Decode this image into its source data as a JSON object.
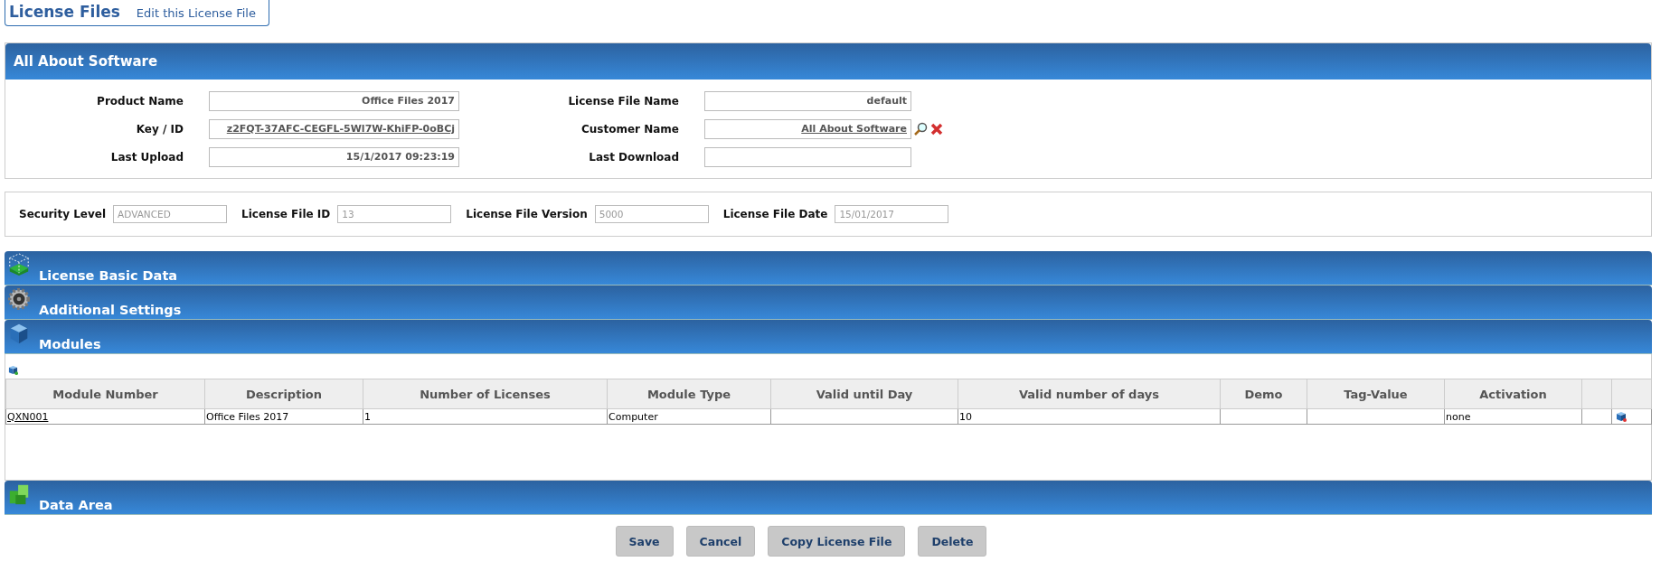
{
  "header_tab": {
    "title": "License Files",
    "link": "Edit this License File"
  },
  "software_panel": {
    "title": "All About Software",
    "fields": [
      {
        "label": "Product Name",
        "value": "Office Files 2017",
        "kind": "text"
      },
      {
        "label": "License File Name",
        "value": "default",
        "kind": "text"
      },
      {
        "label": "Key / ID",
        "value": "z2FQT-37AFC-CEGFL-5Wl7W-KhiFP-0oBCj",
        "kind": "link"
      },
      {
        "label": "Customer Name",
        "value": "All About Software",
        "kind": "lookup"
      },
      {
        "label": "Last Upload",
        "value": "15/1/2017 09:23:19",
        "kind": "text"
      },
      {
        "label": "Last Download",
        "kind": "text"
      }
    ]
  },
  "security_panel": {
    "fields": [
      {
        "label": "Security Level",
        "value": "ADVANCED",
        "disabled": true
      },
      {
        "label": "License File ID",
        "value": "13",
        "disabled": true
      },
      {
        "label": "License File Version",
        "value": "5000",
        "disabled": true
      },
      {
        "label": "License File Date",
        "value": "15/01/2017",
        "disabled": true
      }
    ]
  },
  "sections": [
    {
      "title": "License Basic Data",
      "kind": "basic"
    },
    {
      "title": "Additional Settings",
      "kind": "settings"
    },
    {
      "title": "Modules",
      "kind": "modules"
    }
  ],
  "modules_table": {
    "columns": [
      "Module Number",
      "Description",
      "Number of Licenses",
      "Module Type",
      "Valid until Day",
      "Valid number of days",
      "Demo",
      "Tag-Value",
      "Activation"
    ],
    "rows": [
      [
        "QXN001",
        "Office Files 2017",
        "1",
        "Computer",
        "",
        "10",
        "",
        "",
        "none"
      ]
    ]
  },
  "data_area": {
    "title": "Data Area",
    "kind": "data"
  },
  "buttons": [
    "Save",
    "Cancel",
    "Copy License File",
    "Delete"
  ]
}
